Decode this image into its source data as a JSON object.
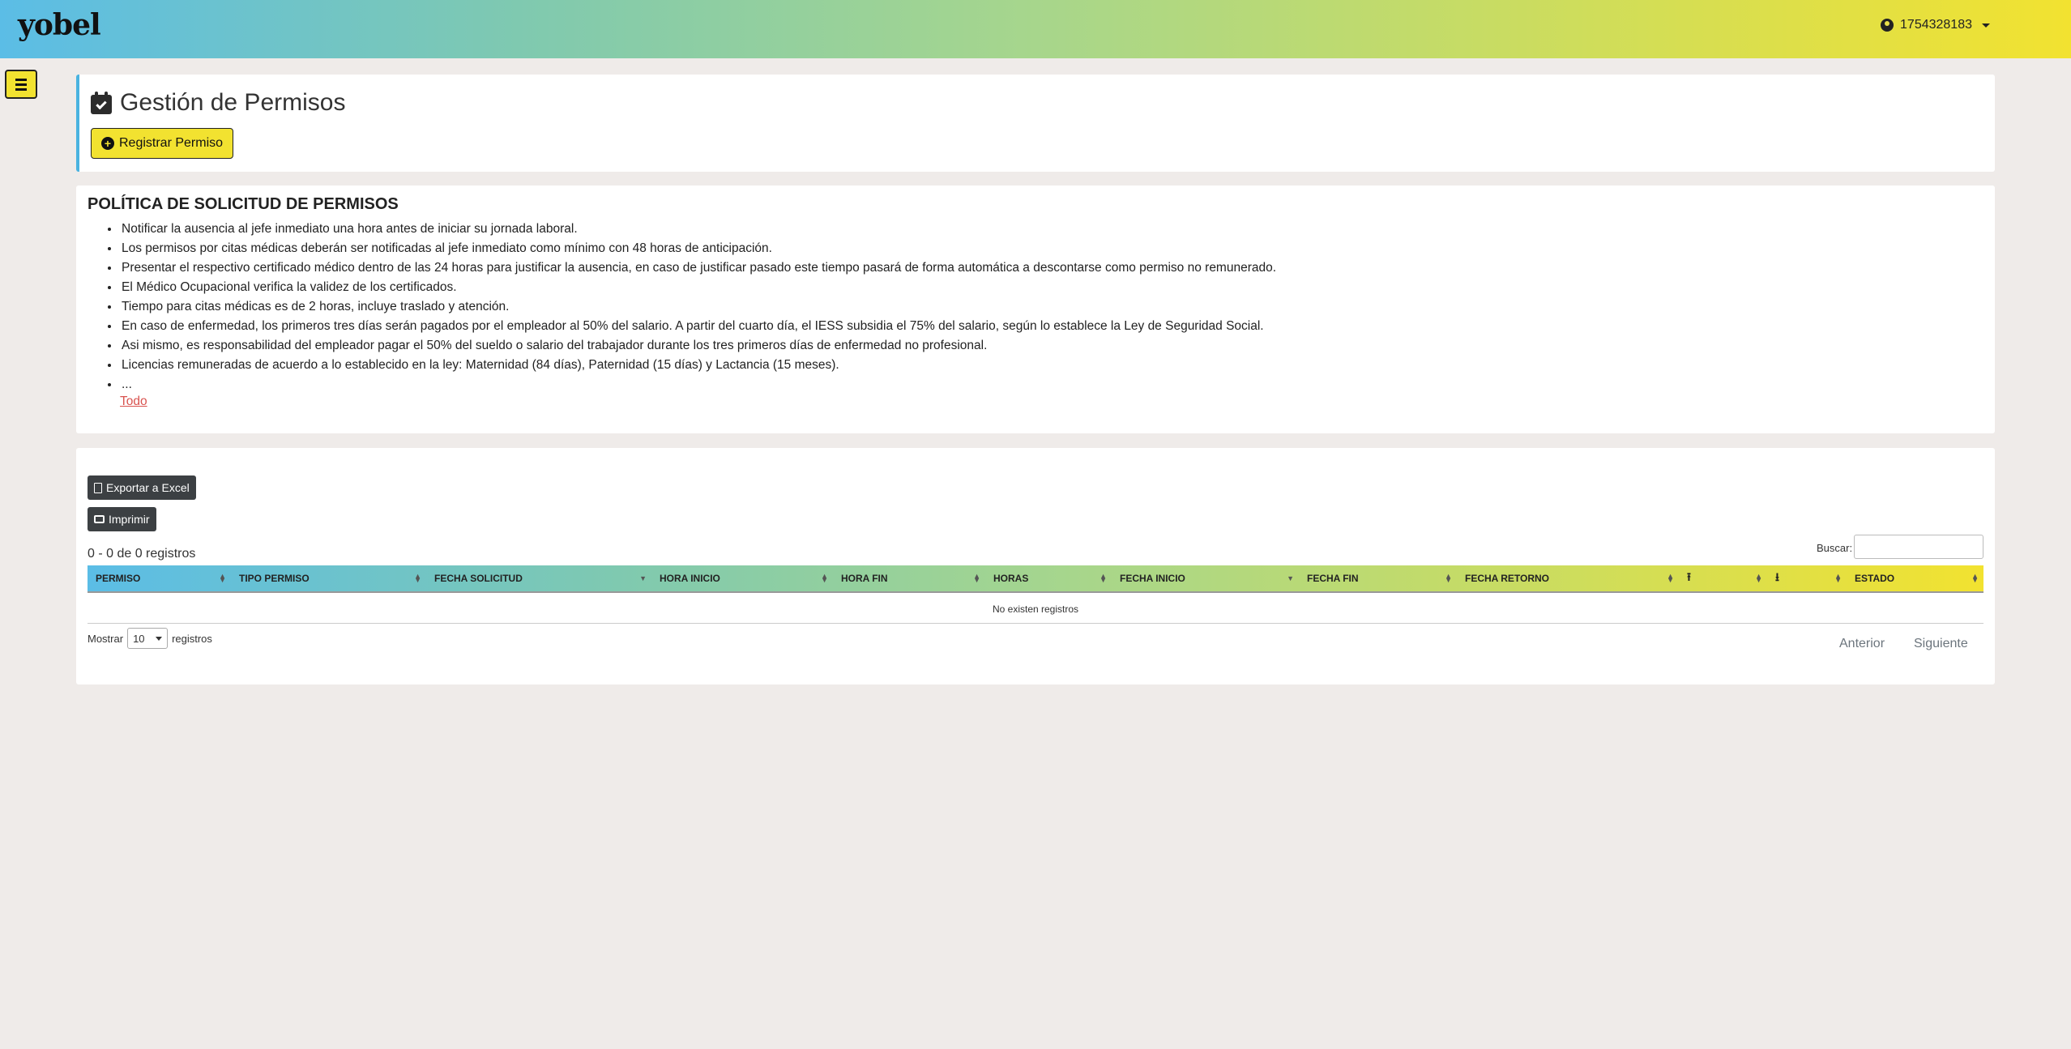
{
  "navbar": {
    "logo": "yobel",
    "user": "1754328183"
  },
  "header": {
    "title": "Gestión de Permisos",
    "register_button": "Registrar Permiso"
  },
  "policy": {
    "title": "POLÍTICA DE SOLICITUD DE PERMISOS",
    "items": [
      "Notificar la ausencia al jefe inmediato una hora antes de iniciar su jornada laboral.",
      "Los permisos por citas médicas deberán ser notificadas al jefe inmediato como mínimo con 48 horas de anticipación.",
      "Presentar el respectivo certificado médico dentro de las 24 horas para justificar la ausencia, en caso de justificar pasado este tiempo pasará de forma automática a descontarse como permiso no remunerado.",
      "El Médico Ocupacional verifica la validez de los certificados.",
      "Tiempo para citas médicas es de 2 horas, incluye traslado y atención.",
      "En caso de enfermedad, los primeros tres días serán pagados por el empleador al 50% del salario. A partir del cuarto día, el IESS subsidia el 75% del salario, según lo establece la Ley de Seguridad Social.",
      "Asi mismo, es responsabilidad del empleador pagar el 50% del sueldo o salario del trabajador durante los tres primeros días de enfermedad no profesional.",
      "Licencias remuneradas de acuerdo a lo establecido en la ley: Maternidad (84 días), Paternidad (15 días) y Lactancia (15 meses).",
      "..."
    ],
    "more_link": "Todo"
  },
  "table": {
    "export_button": "Exportar a Excel",
    "print_button": "Imprimir",
    "info": "0 - 0 de 0 registros",
    "search_label": "Buscar:",
    "search_value": "",
    "columns": [
      "PERMISO",
      "TIPO PERMISO",
      "FECHA SOLICITUD",
      "HORA INICIO",
      "HORA FIN",
      "HORAS",
      "FECHA INICIO",
      "FECHA FIN",
      "FECHA RETORNO",
      "",
      "",
      "ESTADO"
    ],
    "column_icons": [
      "upload-icon",
      "download-icon"
    ],
    "empty_text": "No existen registros",
    "show_label": "Mostrar",
    "show_value": "10",
    "show_suffix": "registros",
    "prev": "Anterior",
    "next": "Siguiente"
  },
  "colors": {
    "accent_yellow": "#f2e230",
    "accent_blue": "#5bbde6",
    "link_red": "#d9534f",
    "dark_button": "#3c4043"
  }
}
